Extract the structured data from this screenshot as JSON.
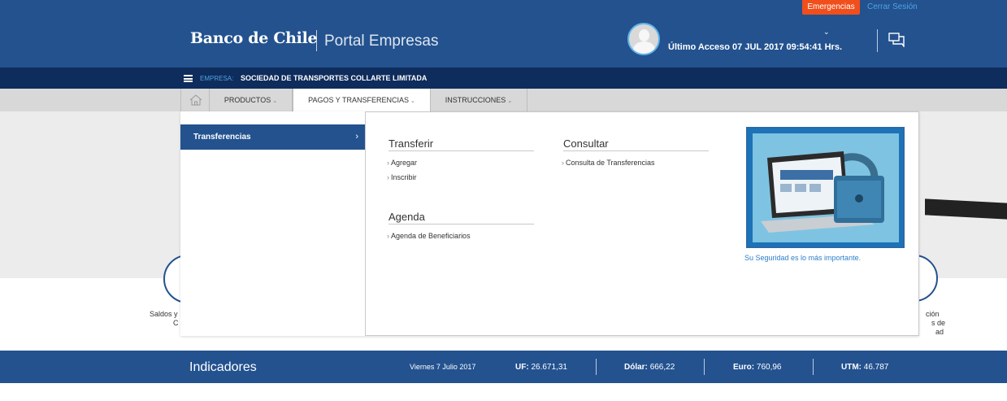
{
  "header": {
    "brand": "Banco de Chile",
    "portal": "Portal Empresas",
    "emergencias": "Emergencias",
    "logout": "Cerrar Sesión",
    "last_access": "Último Acceso 07 JUL 2017 09:54:41 Hrs."
  },
  "empresa": {
    "label": "EMPRESA:",
    "name": "SOCIEDAD DE TRANSPORTES COLLARTE LIMITADA"
  },
  "nav": {
    "tabs": [
      {
        "label": "PRODUCTOS"
      },
      {
        "label": "PAGOS Y TRANSFERENCIAS"
      },
      {
        "label": "INSTRUCCIONES"
      }
    ],
    "active": "PAGOS Y TRANSFERENCIAS"
  },
  "menu": {
    "left_item": "Transferencias",
    "sections": [
      {
        "title": "Transferir",
        "links": [
          "Agregar",
          "Inscribir"
        ]
      },
      {
        "title": "Consultar",
        "links": [
          "Consulta de Transferencias"
        ]
      },
      {
        "title": "Agenda",
        "links": [
          "Agenda de Beneficiarios"
        ]
      }
    ],
    "promo_caption": "Su Seguridad es lo más importante."
  },
  "background": {
    "left_text_1": "Saldos y",
    "left_text_2": "C",
    "right_text_1": "ción",
    "right_text_2": "s de",
    "right_text_3": "ad"
  },
  "footer": {
    "title": "Indicadores",
    "date": "Viernes 7 Julio 2017",
    "uf_label": "UF:",
    "uf_value": "26.671,31",
    "dolar_label": "Dólar:",
    "dolar_value": "666,22",
    "euro_label": "Euro:",
    "euro_value": "760,96",
    "utm_label": "UTM:",
    "utm_value": "46.787"
  },
  "colors": {
    "primary_blue": "#23528f",
    "dark_navy": "#0e2c5c",
    "emergency_orange": "#f04f1c",
    "link_blue": "#4fa3e5"
  }
}
